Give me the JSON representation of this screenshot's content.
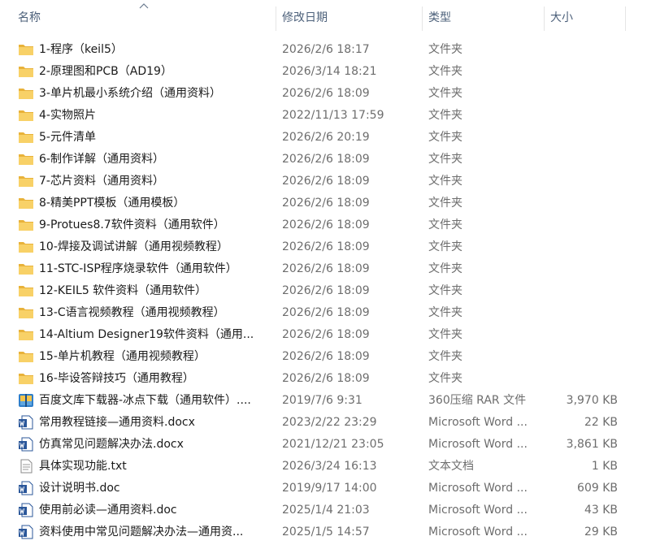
{
  "header": {
    "name": "名称",
    "date": "修改日期",
    "type": "类型",
    "size": "大小"
  },
  "files": [
    {
      "name": "1-程序（keil5）",
      "date": "2026/2/6 18:17",
      "type": "文件夹",
      "size": "",
      "icon": "folder-icon"
    },
    {
      "name": "2-原理图和PCB（AD19）",
      "date": "2026/3/14 18:21",
      "type": "文件夹",
      "size": "",
      "icon": "folder-icon"
    },
    {
      "name": "3-单片机最小系统介绍（通用资料）",
      "date": "2026/2/6 18:09",
      "type": "文件夹",
      "size": "",
      "icon": "folder-icon"
    },
    {
      "name": "4-实物照片",
      "date": "2022/11/13 17:59",
      "type": "文件夹",
      "size": "",
      "icon": "folder-icon"
    },
    {
      "name": "5-元件清单",
      "date": "2026/2/6 20:19",
      "type": "文件夹",
      "size": "",
      "icon": "folder-icon"
    },
    {
      "name": "6-制作详解（通用资料）",
      "date": "2026/2/6 18:09",
      "type": "文件夹",
      "size": "",
      "icon": "folder-icon"
    },
    {
      "name": "7-芯片资料（通用资料）",
      "date": "2026/2/6 18:09",
      "type": "文件夹",
      "size": "",
      "icon": "folder-icon"
    },
    {
      "name": "8-精美PPT模板（通用模板）",
      "date": "2026/2/6 18:09",
      "type": "文件夹",
      "size": "",
      "icon": "folder-icon"
    },
    {
      "name": "9-Protues8.7软件资料（通用软件）",
      "date": "2026/2/6 18:09",
      "type": "文件夹",
      "size": "",
      "icon": "folder-icon"
    },
    {
      "name": "10-焊接及调试讲解（通用视频教程）",
      "date": "2026/2/6 18:09",
      "type": "文件夹",
      "size": "",
      "icon": "folder-icon"
    },
    {
      "name": "11-STC-ISP程序烧录软件（通用软件）",
      "date": "2026/2/6 18:09",
      "type": "文件夹",
      "size": "",
      "icon": "folder-icon"
    },
    {
      "name": "12-KEIL5 软件资料（通用软件）",
      "date": "2026/2/6 18:09",
      "type": "文件夹",
      "size": "",
      "icon": "folder-icon"
    },
    {
      "name": "13-C语言视频教程（通用视频教程）",
      "date": "2026/2/6 18:09",
      "type": "文件夹",
      "size": "",
      "icon": "folder-icon"
    },
    {
      "name": "14-Altium Designer19软件资料（通用...",
      "date": "2026/2/6 18:09",
      "type": "文件夹",
      "size": "",
      "icon": "folder-icon"
    },
    {
      "name": "15-单片机教程（通用视频教程）",
      "date": "2026/2/6 18:09",
      "type": "文件夹",
      "size": "",
      "icon": "folder-icon"
    },
    {
      "name": "16-毕设答辩技巧（通用教程）",
      "date": "2026/2/6 18:09",
      "type": "文件夹",
      "size": "",
      "icon": "folder-icon"
    },
    {
      "name": "百度文库下载器-冰点下载（通用软件）....",
      "date": "2019/7/6 9:31",
      "type": "360压缩 RAR 文件",
      "size": "3,970 KB",
      "icon": "rar-archive-icon"
    },
    {
      "name": "常用教程链接—通用资料.docx",
      "date": "2023/2/22 23:29",
      "type": "Microsoft Word ...",
      "size": "22 KB",
      "icon": "word-document-icon"
    },
    {
      "name": "仿真常见问题解决办法.docx",
      "date": "2021/12/21 23:05",
      "type": "Microsoft Word ...",
      "size": "3,861 KB",
      "icon": "word-document-icon"
    },
    {
      "name": "具体实现功能.txt",
      "date": "2026/3/24 16:13",
      "type": "文本文档",
      "size": "1 KB",
      "icon": "text-file-icon"
    },
    {
      "name": "设计说明书.doc",
      "date": "2019/9/17 14:00",
      "type": "Microsoft Word ...",
      "size": "609 KB",
      "icon": "word-document-icon"
    },
    {
      "name": "使用前必读—通用资料.doc",
      "date": "2025/1/4 21:03",
      "type": "Microsoft Word ...",
      "size": "43 KB",
      "icon": "word-document-icon"
    },
    {
      "name": "资料使用中常见问题解决办法—通用资...",
      "date": "2025/1/5 14:57",
      "type": "Microsoft Word ...",
      "size": "29 KB",
      "icon": "word-document-icon"
    }
  ]
}
